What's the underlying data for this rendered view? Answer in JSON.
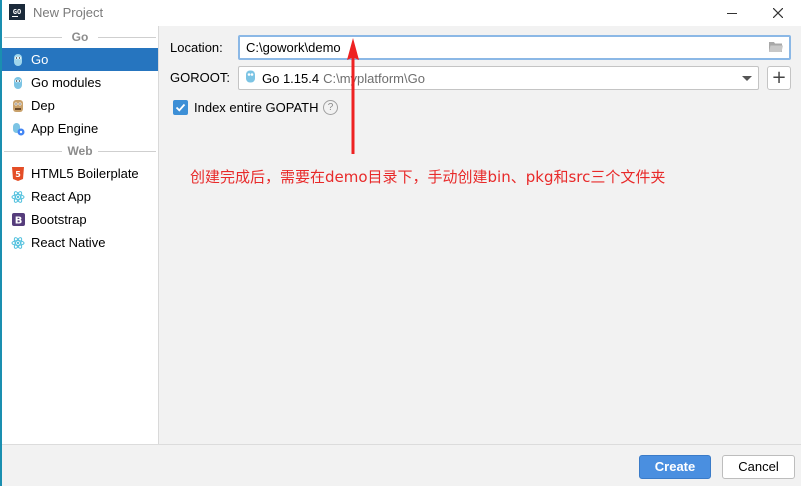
{
  "window": {
    "title": "New Project",
    "app_icon_text": "GO"
  },
  "sidebar": {
    "groups": [
      {
        "header": "Go",
        "items": [
          {
            "label": "Go",
            "icon": "gopher-icon",
            "selected": true
          },
          {
            "label": "Go modules",
            "icon": "gopher-icon"
          },
          {
            "label": "Dep",
            "icon": "dep-icon"
          },
          {
            "label": "App Engine",
            "icon": "app-engine-icon"
          }
        ]
      },
      {
        "header": "Web",
        "items": [
          {
            "label": "HTML5 Boilerplate",
            "icon": "html5-icon"
          },
          {
            "label": "React App",
            "icon": "react-icon"
          },
          {
            "label": "Bootstrap",
            "icon": "bootstrap-icon"
          },
          {
            "label": "React Native",
            "icon": "react-icon"
          }
        ]
      }
    ]
  },
  "form": {
    "location_label": "Location:",
    "location_value": "C:\\gowork\\demo",
    "goroot_label": "GOROOT:",
    "goroot_version": "Go 1.15.4",
    "goroot_path": "C:\\myplatform\\Go",
    "index_gopath_label": "Index entire GOPATH",
    "index_gopath_checked": true,
    "help_symbol": "?"
  },
  "annotation": {
    "text": "创建完成后，需要在demo目录下，手动创建bin、pkg和src三个文件夹",
    "color": "#e82a2a"
  },
  "footer": {
    "create_label": "Create",
    "cancel_label": "Cancel"
  },
  "colors": {
    "selection": "#2675bf",
    "primary_button": "#4a8fe0"
  }
}
